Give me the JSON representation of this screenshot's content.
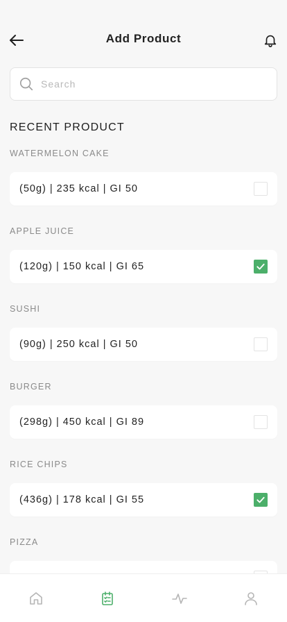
{
  "header": {
    "title": "Add Product"
  },
  "search": {
    "placeholder": "Search",
    "value": ""
  },
  "section_title": "RECENT PRODUCT",
  "products": [
    {
      "name": "WATERMELON CAKE",
      "info": "(50g) | 235 kcal | GI 50",
      "checked": false
    },
    {
      "name": "APPLE JUICE",
      "info": "(120g) | 150 kcal | GI 65",
      "checked": true
    },
    {
      "name": "SUSHI",
      "info": "(90g) | 250 kcal | GI 50",
      "checked": false
    },
    {
      "name": "BURGER",
      "info": "(298g) | 450 kcal | GI 89",
      "checked": false
    },
    {
      "name": "RICE CHIPS",
      "info": "(436g) | 178 kcal | GI 55",
      "checked": true
    },
    {
      "name": "PIZZA",
      "info": "",
      "checked": false
    }
  ],
  "nav": {
    "items": [
      {
        "icon": "home-icon",
        "active": false
      },
      {
        "icon": "diary-icon",
        "active": true
      },
      {
        "icon": "activity-icon",
        "active": false
      },
      {
        "icon": "profile-icon",
        "active": false
      }
    ]
  },
  "colors": {
    "accent": "#4caf6a",
    "inactive_icon": "#b5b5b5",
    "background": "#f7f7f7"
  }
}
